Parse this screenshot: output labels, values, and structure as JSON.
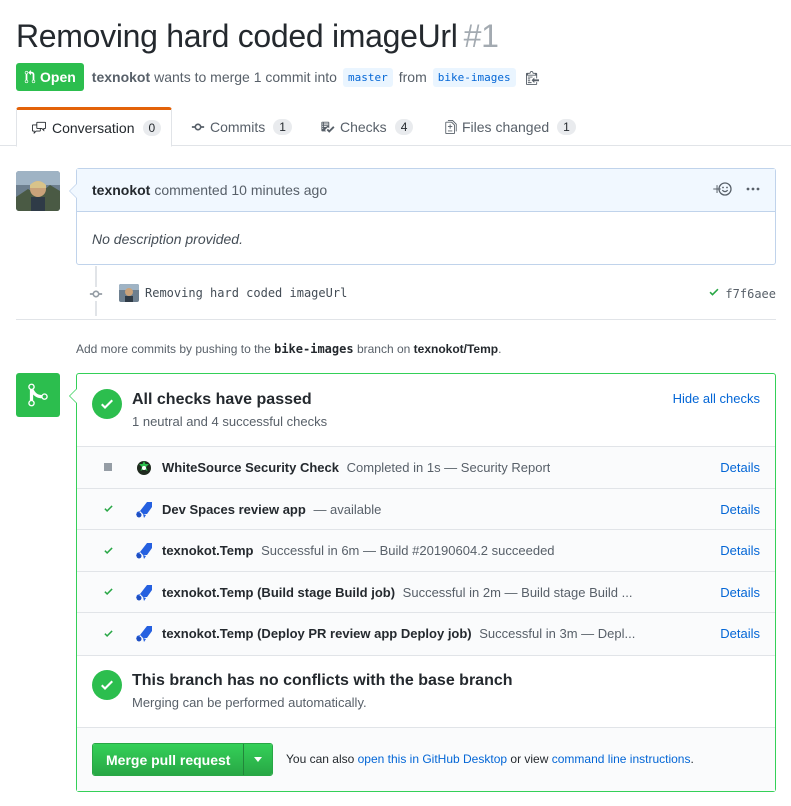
{
  "pr": {
    "title": "Removing hard coded imageUrl",
    "number": "#1",
    "state": "Open",
    "author": "texnokot",
    "merge_text_1": "wants to merge 1 commit into",
    "base_branch": "master",
    "merge_text_2": "from",
    "head_branch": "bike-images"
  },
  "tabs": [
    {
      "label": "Conversation",
      "count": "0",
      "icon": "comment-discussion-icon"
    },
    {
      "label": "Commits",
      "count": "1",
      "icon": "git-commit-icon"
    },
    {
      "label": "Checks",
      "count": "4",
      "icon": "checklist-icon"
    },
    {
      "label": "Files changed",
      "count": "1",
      "icon": "file-diff-icon"
    }
  ],
  "comment": {
    "author": "texnokot",
    "action": "commented",
    "time": "10 minutes ago",
    "body": "No description provided."
  },
  "commit": {
    "message": "Removing hard coded imageUrl",
    "sha": "f7f6aee"
  },
  "hint": {
    "prefix": "Add more commits by pushing to the",
    "branch": "bike-images",
    "middle": "branch on",
    "repo": "texnokot/Temp",
    "suffix": "."
  },
  "checks_summary": {
    "title": "All checks have passed",
    "subtitle": "1 neutral and 4 successful checks",
    "hide_label": "Hide all checks"
  },
  "checks": [
    {
      "status": "neutral",
      "name": "WhiteSource Security Check",
      "desc": "Completed in 1s — Security Report",
      "details": "Details"
    },
    {
      "status": "success",
      "name": "Dev Spaces review app",
      "desc": "— available",
      "details": "Details"
    },
    {
      "status": "success",
      "name": "texnokot.Temp",
      "desc": "Successful in 6m — Build #20190604.2 succeeded",
      "details": "Details"
    },
    {
      "status": "success",
      "name": "texnokot.Temp (Build stage Build job)",
      "desc": "Successful in 2m — Build stage Build ...",
      "details": "Details"
    },
    {
      "status": "success",
      "name": "texnokot.Temp (Deploy PR review app Deploy job)",
      "desc": "Successful in 3m — Depl...",
      "details": "Details"
    }
  ],
  "conflicts": {
    "title": "This branch has no conflicts with the base branch",
    "subtitle": "Merging can be performed automatically."
  },
  "merge": {
    "button_label": "Merge pull request",
    "also_prefix": "You can also",
    "desktop_link": "open this in GitHub Desktop",
    "or_view": "or view",
    "cli_link": "command line instructions",
    "suffix": "."
  },
  "colors": {
    "success": "#2cbe4e",
    "link": "#0366d6",
    "comment_header_bg": "#f1f8ff"
  }
}
